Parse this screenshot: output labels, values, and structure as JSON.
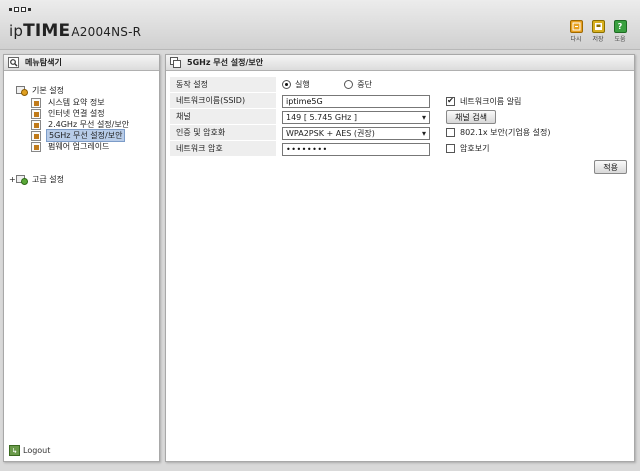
{
  "header": {
    "brand_pre": "ip",
    "brand_bold": "TIME",
    "model": "A2004NS-R",
    "buttons": [
      {
        "icon": "refresh-icon",
        "label": "다시",
        "color": "#e8a020"
      },
      {
        "icon": "save-icon",
        "label": "저장",
        "color": "#e0a020"
      },
      {
        "icon": "help-icon",
        "label": "도움",
        "color": "#3aa040",
        "glyph": "?"
      }
    ]
  },
  "sidebar": {
    "title": "메뉴탐색기",
    "basic_group": "기본 설정",
    "items": [
      {
        "label": "시스템 요약 정보",
        "active": false
      },
      {
        "label": "인터넷 연결 설정",
        "active": false
      },
      {
        "label": "2.4GHz 무선 설정/보안",
        "active": false
      },
      {
        "label": "5GHz 무선 설정/보안",
        "active": true
      },
      {
        "label": "펌웨어 업그레이드",
        "active": false
      }
    ],
    "advanced_group": "고급 설정",
    "logout": "Logout"
  },
  "main": {
    "title": "5GHz 무선 설정/보안",
    "rows": {
      "operation_label": "동작 설정",
      "operation_on": "실행",
      "operation_off": "중단",
      "ssid_label": "네트워크이름(SSID)",
      "ssid_value": "iptime5G",
      "ssid_broadcast_label": "네트워크이름 알림",
      "channel_label": "채널",
      "channel_value": "149 [ 5.745 GHz ]",
      "channel_search": "채널 검색",
      "auth_label": "인증 및 암호화",
      "auth_value": "WPA2PSK + AES (권장)",
      "dot1x_label": "802.1x 보안(기업용 설정)",
      "password_label": "네트워크 암호",
      "password_value": "••••••••",
      "show_password_label": "암호보기"
    },
    "apply": "적용"
  }
}
